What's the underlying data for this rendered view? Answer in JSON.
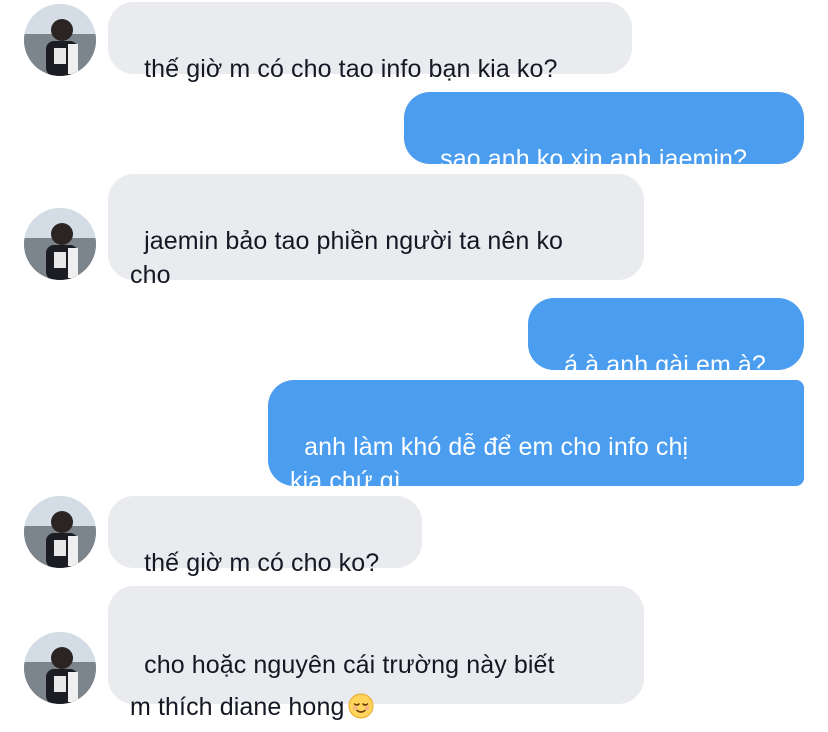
{
  "colors": {
    "incoming_bubble": "#e9ebef",
    "outgoing_bubble": "#4b9df0",
    "incoming_text": "#141823",
    "outgoing_text": "#ffffff"
  },
  "messages": [
    {
      "side": "incoming",
      "text": "thế giờ m có cho tao info bạn kia ko?"
    },
    {
      "side": "outgoing",
      "text": "sao anh ko xin anh jaemin?"
    },
    {
      "side": "incoming",
      "text": "jaemin bảo tao phiền người ta nên ko\ncho"
    },
    {
      "side": "outgoing",
      "text": "á à anh gài em à?"
    },
    {
      "side": "outgoing",
      "text": "anh làm khó dễ để em cho info chị\nkia chứ gì"
    },
    {
      "side": "incoming",
      "text": "thế giờ m có cho ko?"
    },
    {
      "side": "incoming",
      "text": "cho hoặc nguyên cái trường này biết\nm thích diane hong",
      "emoji": "relieved-face-icon"
    }
  ]
}
